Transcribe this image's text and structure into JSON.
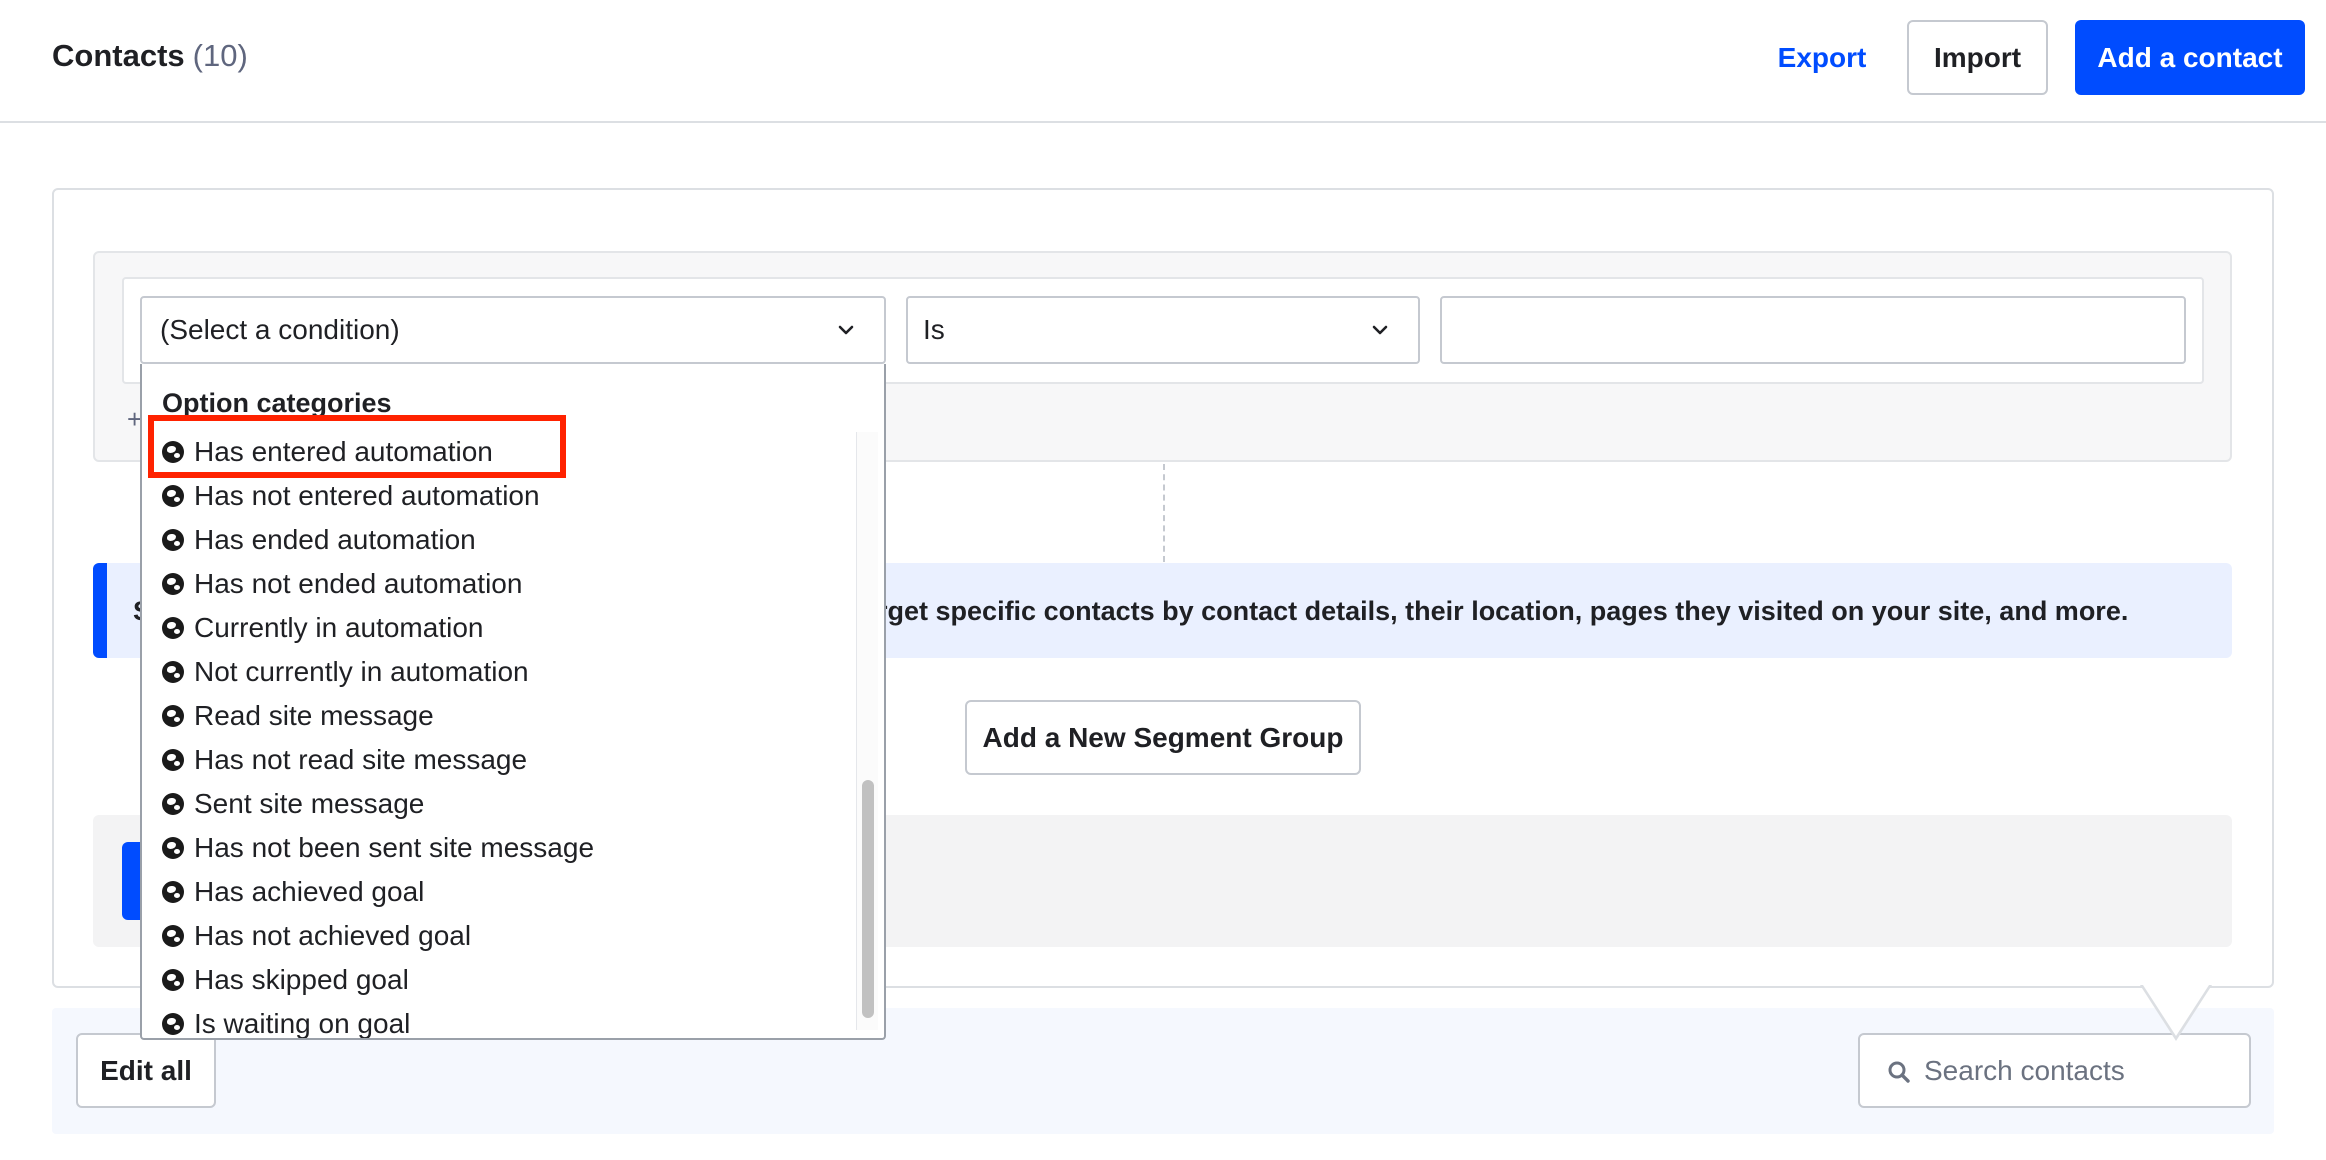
{
  "header": {
    "title": "Contacts",
    "count": "(10)",
    "export_label": "Export",
    "import_label": "Import",
    "add_contact_label": "Add a contact"
  },
  "segment": {
    "condition_select": {
      "selected": "(Select a condition)"
    },
    "operator_select": {
      "selected": "Is"
    },
    "value_input": {
      "value": "",
      "placeholder": ""
    },
    "add_condition_symbol": "+",
    "info_prefix": "S",
    "info_text": "arget specific contacts by contact details, their location, pages they visited on your site, and more.",
    "add_segment_group_label": "Add a New Segment Group"
  },
  "dropdown": {
    "header": "Option categories",
    "options": [
      "Has entered automation",
      "Has not entered automation",
      "Has ended automation",
      "Has not ended automation",
      "Currently in automation",
      "Not currently in automation",
      "Read site message",
      "Has not read site message",
      "Sent site message",
      "Has not been sent site message",
      "Has achieved goal",
      "Has not achieved goal",
      "Has skipped goal",
      "Is waiting on goal"
    ],
    "highlighted_index": 0,
    "option_icon": "globe-icon",
    "scroll_position": 0.59
  },
  "toolbar": {
    "edit_all_label": "Edit all",
    "search_placeholder": "Search contacts",
    "search_value": ""
  },
  "colors": {
    "primary": "#004cff",
    "highlight": "#ff2200",
    "info_background": "#eaf0ff"
  }
}
